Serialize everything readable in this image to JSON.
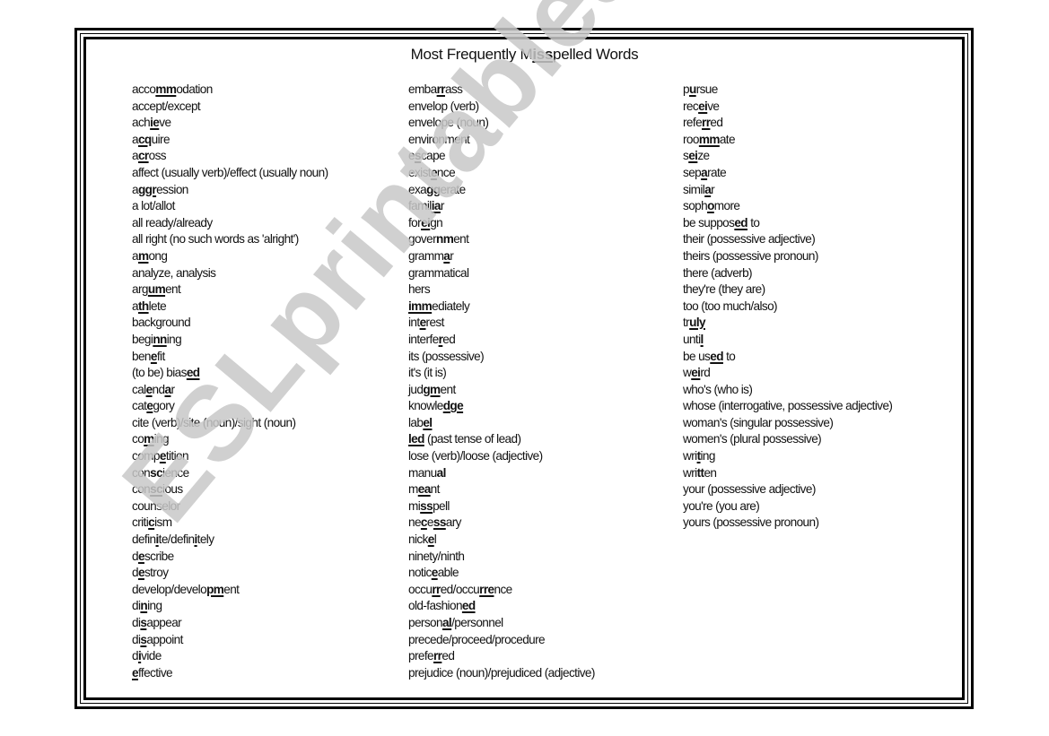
{
  "title": {
    "parts": [
      {
        "text": "Most Frequently M",
        "bold": false
      },
      {
        "text": "iss",
        "bold": true
      },
      {
        "text": "pelled Words",
        "bold": false
      }
    ]
  },
  "watermark": "ESLprintables.com",
  "columns": [
    [
      [
        [
          "acco"
        ],
        [
          "mm",
          "u"
        ],
        [
          "odation"
        ]
      ],
      [
        [
          "accept/except"
        ]
      ],
      [
        [
          "ach"
        ],
        [
          "ie",
          "u"
        ],
        [
          "ve"
        ]
      ],
      [
        [
          "a"
        ],
        [
          "cq",
          "u"
        ],
        [
          "uire"
        ]
      ],
      [
        [
          "a"
        ],
        [
          "cr",
          "u"
        ],
        [
          "oss"
        ]
      ],
      [
        [
          "affect (usually verb)/effect (usually noun)"
        ]
      ],
      [
        [
          "a"
        ],
        [
          "ggr",
          "u"
        ],
        [
          "ession"
        ]
      ],
      [
        [
          "a lot/allot"
        ]
      ],
      [
        [
          "all ready/already"
        ]
      ],
      [
        [
          "all right (no such words as 'alright')"
        ]
      ],
      [
        [
          "a"
        ],
        [
          "m",
          "u"
        ],
        [
          "ong"
        ]
      ],
      [
        [
          "analyze, analysis"
        ]
      ],
      [
        [
          "arg"
        ],
        [
          "um",
          "u"
        ],
        [
          "ent"
        ]
      ],
      [
        [
          "a"
        ],
        [
          "th",
          "u"
        ],
        [
          "lete"
        ]
      ],
      [
        [
          "background"
        ]
      ],
      [
        [
          "begi"
        ],
        [
          "nn",
          "u"
        ],
        [
          "ing"
        ]
      ],
      [
        [
          "ben"
        ],
        [
          "e",
          "u"
        ],
        [
          "fit"
        ]
      ],
      [
        [
          "(to be) bias"
        ],
        [
          "ed",
          "u"
        ]
      ],
      [
        [
          "cal"
        ],
        [
          "e",
          "u"
        ],
        [
          "nd"
        ],
        [
          "a",
          "u"
        ],
        [
          "r"
        ]
      ],
      [
        [
          "cat"
        ],
        [
          "e",
          "u"
        ],
        [
          "gory"
        ]
      ],
      [
        [
          "cite (verb)/site (noun)/sight (noun)"
        ]
      ],
      [
        [
          "co"
        ],
        [
          "m",
          "u"
        ],
        [
          "ing"
        ]
      ],
      [
        [
          "comp"
        ],
        [
          "e",
          "u"
        ],
        [
          "tition"
        ]
      ],
      [
        [
          "con"
        ],
        [
          "sc",
          "b"
        ],
        [
          "ience"
        ]
      ],
      [
        [
          "con"
        ],
        [
          "sc",
          "u"
        ],
        [
          "ious"
        ]
      ],
      [
        [
          "counselor"
        ]
      ],
      [
        [
          "criti"
        ],
        [
          "c",
          "u"
        ],
        [
          "ism"
        ]
      ],
      [
        [
          "defin"
        ],
        [
          "i",
          "u"
        ],
        [
          "te/defin"
        ],
        [
          "i",
          "u"
        ],
        [
          "tely"
        ]
      ],
      [
        [
          "d"
        ],
        [
          "e",
          "u"
        ],
        [
          "scribe"
        ]
      ],
      [
        [
          "d"
        ],
        [
          "e",
          "u"
        ],
        [
          "stroy"
        ]
      ],
      [
        [
          "develop/develo"
        ],
        [
          "pm",
          "u"
        ],
        [
          "ent"
        ]
      ],
      [
        [
          "di"
        ],
        [
          "n",
          "u"
        ],
        [
          "ing"
        ]
      ],
      [
        [
          "di"
        ],
        [
          "s",
          "u"
        ],
        [
          "appear"
        ]
      ],
      [
        [
          "di"
        ],
        [
          "s",
          "u"
        ],
        [
          "appoint"
        ]
      ],
      [
        [
          "d"
        ],
        [
          "i",
          "u"
        ],
        [
          "vide"
        ]
      ],
      [
        [
          "e",
          "u"
        ],
        [
          "ffective"
        ]
      ]
    ],
    [
      [
        [
          "emba"
        ],
        [
          "rr",
          "u"
        ],
        [
          "ass"
        ]
      ],
      [
        [
          "envelop (verb)"
        ]
      ],
      [
        [
          "envelope (noun)"
        ]
      ],
      [
        [
          "environment"
        ]
      ],
      [
        [
          "e"
        ],
        [
          "s",
          "u"
        ],
        [
          "cape"
        ]
      ],
      [
        [
          "exist"
        ],
        [
          "e",
          "u"
        ],
        [
          "nce"
        ]
      ],
      [
        [
          "exa"
        ],
        [
          "gg",
          "u"
        ],
        [
          "erate"
        ]
      ],
      [
        [
          "famil"
        ],
        [
          "ia",
          "u"
        ],
        [
          "r"
        ]
      ],
      [
        [
          "for"
        ],
        [
          "ei",
          "u"
        ],
        [
          "gn"
        ]
      ],
      [
        [
          "gover"
        ],
        [
          "nm",
          "b"
        ],
        [
          "ent"
        ]
      ],
      [
        [
          "gramm"
        ],
        [
          "a",
          "u"
        ],
        [
          "r"
        ]
      ],
      [
        [
          "grammatical"
        ]
      ],
      [
        [
          "hers"
        ]
      ],
      [
        [
          "imm",
          "u"
        ],
        [
          "ediately"
        ]
      ],
      [
        [
          "int"
        ],
        [
          "e",
          "u"
        ],
        [
          "rest"
        ]
      ],
      [
        [
          "interfe"
        ],
        [
          "r",
          "u"
        ],
        [
          "ed"
        ]
      ],
      [
        [
          "its (possessive)"
        ]
      ],
      [
        [
          "it's (it is)"
        ]
      ],
      [
        [
          "jud"
        ],
        [
          "gm",
          "u"
        ],
        [
          "ent"
        ]
      ],
      [
        [
          "knowle"
        ],
        [
          "dge",
          "u"
        ]
      ],
      [
        [
          "lab"
        ],
        [
          "el",
          "u"
        ]
      ],
      [
        [
          "led",
          "u"
        ],
        [
          " (past tense of lead)"
        ]
      ],
      [
        [
          "lose (verb)/loose (adjective)"
        ]
      ],
      [
        [
          "manu"
        ],
        [
          "al",
          "b"
        ]
      ],
      [
        [
          "m"
        ],
        [
          "ea",
          "u"
        ],
        [
          "nt"
        ]
      ],
      [
        [
          "mi"
        ],
        [
          "ss",
          "u"
        ],
        [
          "pell"
        ]
      ],
      [
        [
          "ne"
        ],
        [
          "c",
          "u"
        ],
        [
          "e"
        ],
        [
          "ss",
          "u"
        ],
        [
          "ary"
        ]
      ],
      [
        [
          "nick"
        ],
        [
          "e",
          "u"
        ],
        [
          "l"
        ]
      ],
      [
        [
          "ninety/ninth"
        ]
      ],
      [
        [
          "notic"
        ],
        [
          "e",
          "u"
        ],
        [
          "able"
        ]
      ],
      [
        [
          "occu"
        ],
        [
          "rr",
          "u"
        ],
        [
          "ed/occu"
        ],
        [
          "rre",
          "u"
        ],
        [
          "nce"
        ]
      ],
      [
        [
          "old-fashion"
        ],
        [
          "ed",
          "u"
        ]
      ],
      [
        [
          "person"
        ],
        [
          "al",
          "u"
        ],
        [
          "/personnel"
        ]
      ],
      [
        [
          "precede/proceed/procedure"
        ]
      ],
      [
        [
          "prefe"
        ],
        [
          "rr",
          "u"
        ],
        [
          "ed"
        ]
      ],
      [
        [
          "prejudice (noun)/prejudiced (adjective)"
        ]
      ]
    ],
    [
      [
        [
          "p"
        ],
        [
          "u",
          "u"
        ],
        [
          "rsue"
        ]
      ],
      [
        [
          "rec"
        ],
        [
          "ei",
          "u"
        ],
        [
          "ve"
        ]
      ],
      [
        [
          "refe"
        ],
        [
          "rr",
          "u"
        ],
        [
          "ed"
        ]
      ],
      [
        [
          "roo"
        ],
        [
          "mm",
          "u"
        ],
        [
          "ate"
        ]
      ],
      [
        [
          "s"
        ],
        [
          "ei",
          "u"
        ],
        [
          "ze"
        ]
      ],
      [
        [
          "sep"
        ],
        [
          "a",
          "u"
        ],
        [
          "rate"
        ]
      ],
      [
        [
          "simil"
        ],
        [
          "a",
          "u"
        ],
        [
          "r"
        ]
      ],
      [
        [
          "soph"
        ],
        [
          "o",
          "u"
        ],
        [
          "more"
        ]
      ],
      [
        [
          "be suppos"
        ],
        [
          "ed",
          "u"
        ],
        [
          " to"
        ]
      ],
      [
        [
          "their (possessive adjective)"
        ]
      ],
      [
        [
          "theirs (possessive pronoun)"
        ]
      ],
      [
        [
          "there (adverb)"
        ]
      ],
      [
        [
          "they're (they are)"
        ]
      ],
      [
        [
          "too (too much/also)"
        ]
      ],
      [
        [
          "tr"
        ],
        [
          "uly",
          "u"
        ]
      ],
      [
        [
          "unti"
        ],
        [
          "l",
          "u"
        ]
      ],
      [
        [
          "be us"
        ],
        [
          "ed",
          "u"
        ],
        [
          " to"
        ]
      ],
      [
        [
          "w"
        ],
        [
          "ei",
          "u"
        ],
        [
          "rd"
        ]
      ],
      [
        [
          "who's (who is)"
        ]
      ],
      [
        [
          "whose (interrogative, possessive adjective)"
        ]
      ],
      [
        [
          "woman's (singular possessive)"
        ]
      ],
      [
        [
          "women's (plural possessive)"
        ]
      ],
      [
        [
          "wri"
        ],
        [
          "t",
          "u"
        ],
        [
          "ing"
        ]
      ],
      [
        [
          "wri"
        ],
        [
          "tt",
          "b"
        ],
        [
          "en"
        ]
      ],
      [
        [
          "your (possessive adjective)"
        ]
      ],
      [
        [
          "you're (you are)"
        ]
      ],
      [
        [
          "yours (possessive pronoun)"
        ]
      ]
    ]
  ]
}
